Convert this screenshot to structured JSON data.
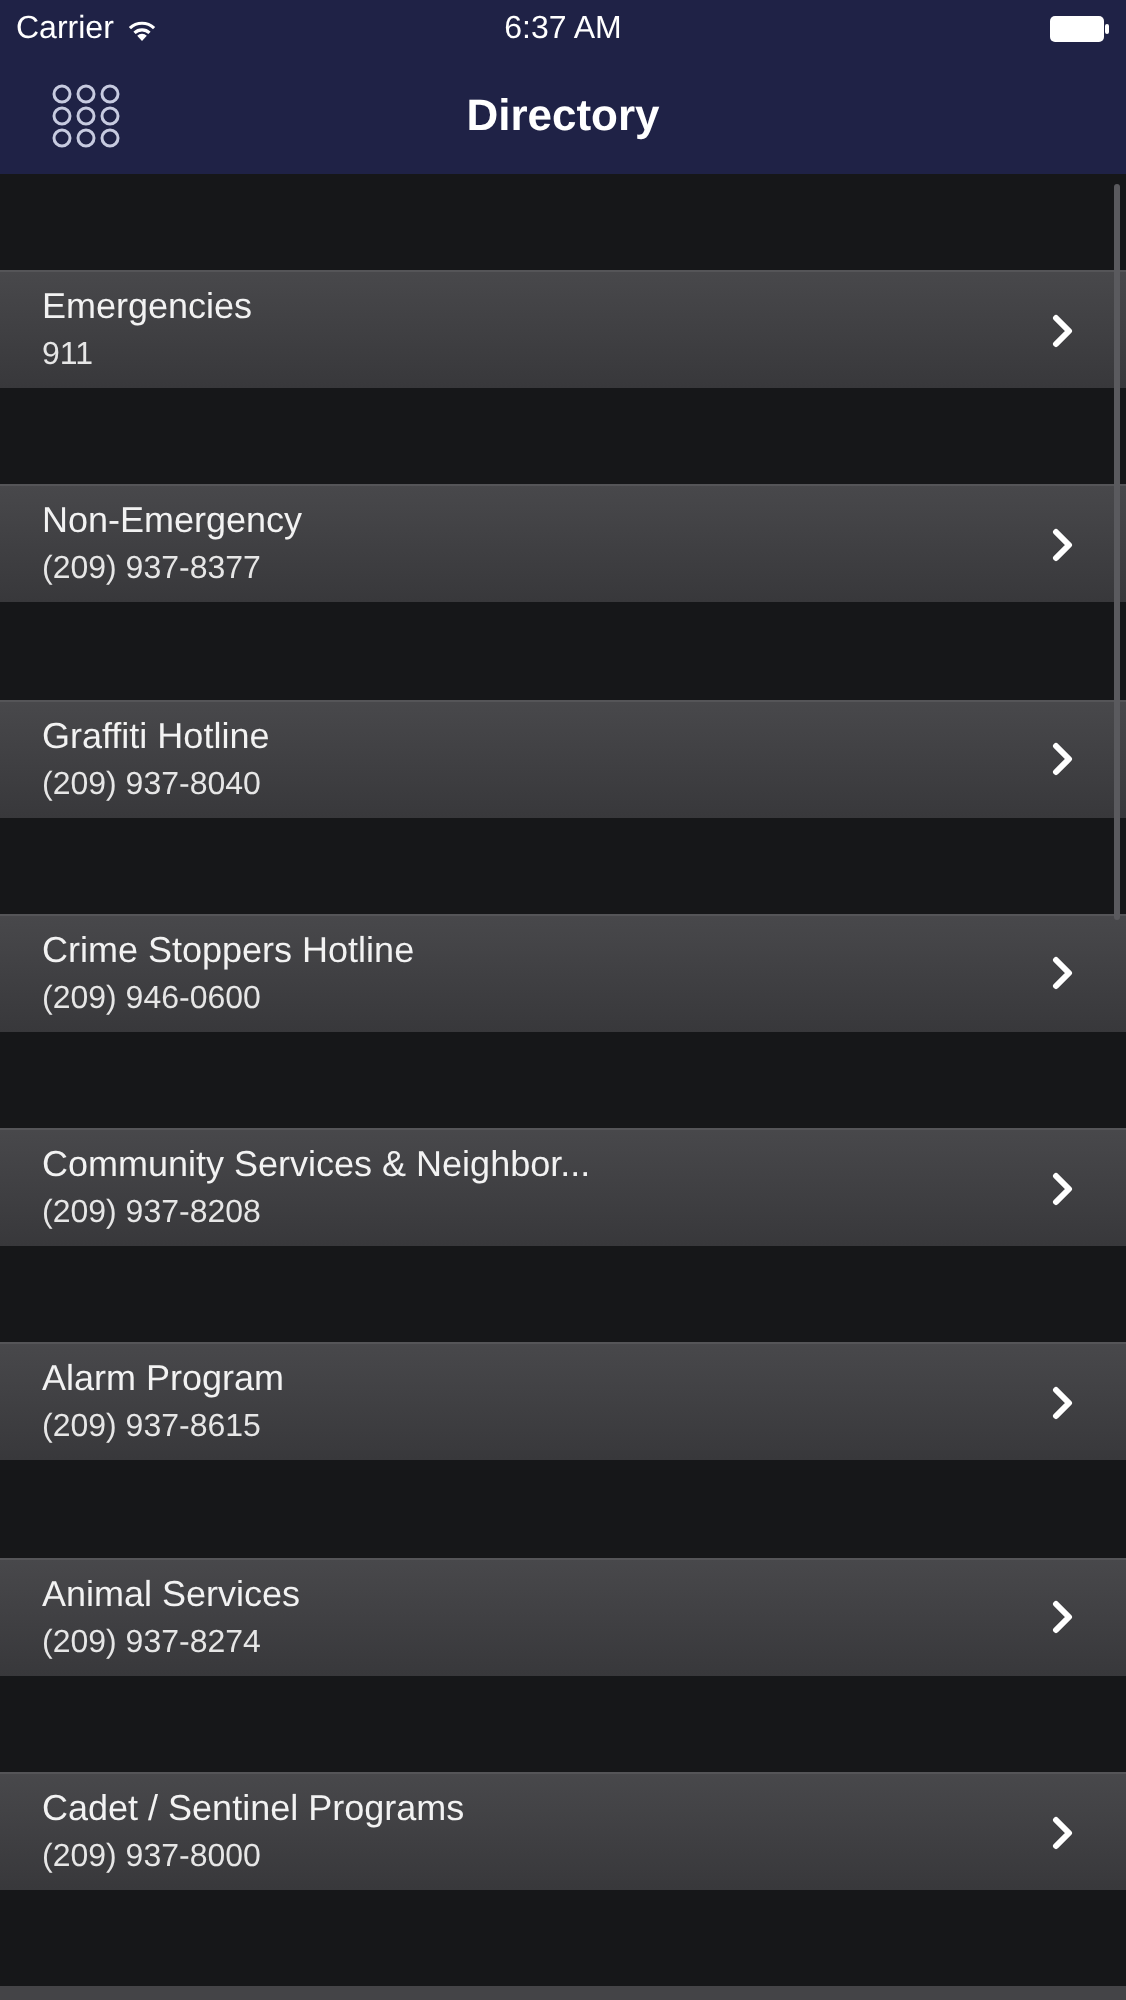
{
  "status_bar": {
    "carrier": "Carrier",
    "time": "6:37 AM"
  },
  "nav_bar": {
    "title": "Directory"
  },
  "items": [
    {
      "name": "Emergencies",
      "phone": "911"
    },
    {
      "name": "Non-Emergency",
      "phone": "(209) 937-8377"
    },
    {
      "name": "Graffiti Hotline",
      "phone": "(209) 937-8040"
    },
    {
      "name": "Crime Stoppers Hotline",
      "phone": "(209) 946-0600"
    },
    {
      "name": "Community Services & Neighbor...",
      "phone": "(209) 937-8208"
    },
    {
      "name": "Alarm Program",
      "phone": "(209) 937-8615"
    },
    {
      "name": "Animal Services",
      "phone": "(209) 937-8274"
    },
    {
      "name": "Cadet / Sentinel Programs",
      "phone": "(209) 937-8000"
    }
  ]
}
